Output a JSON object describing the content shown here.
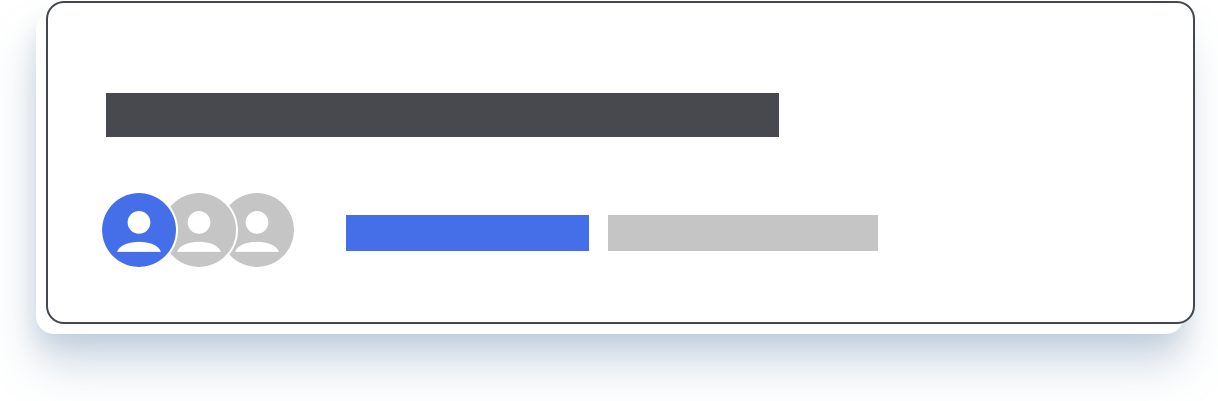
{
  "colors": {
    "title_placeholder": "#48494e",
    "accent": "#456fe8",
    "muted": "#c5c5c5",
    "card_border": "#44474f",
    "avatar_figure": "#ffffff"
  },
  "avatars": [
    {
      "icon": "user-icon",
      "color": "#456fe8",
      "state": "active"
    },
    {
      "icon": "user-icon",
      "color": "#c5c5c5",
      "state": "inactive"
    },
    {
      "icon": "user-icon",
      "color": "#c5c5c5",
      "state": "inactive"
    }
  ],
  "placeholders": {
    "title": "title-placeholder-bar",
    "meta_primary": "primary-meta-placeholder-bar",
    "meta_secondary": "secondary-meta-placeholder-bar"
  }
}
